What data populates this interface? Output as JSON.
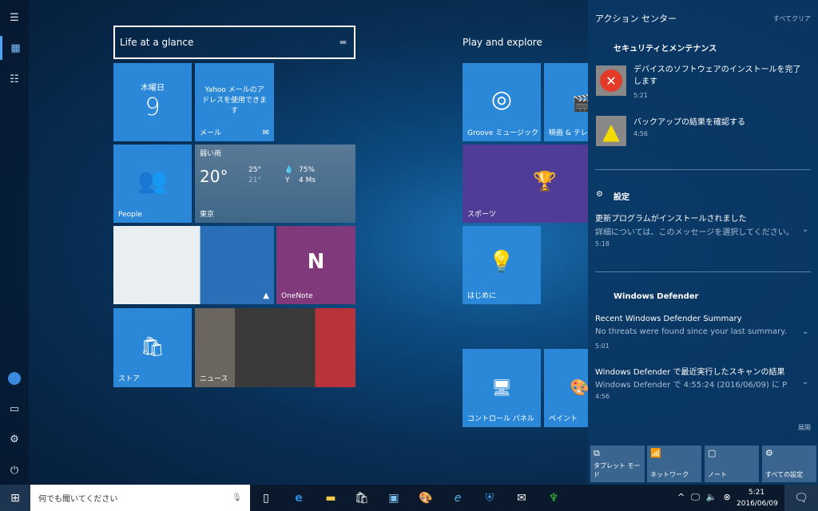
{
  "left_rail": {
    "icons": [
      "hamburger-icon",
      "tiles-icon",
      "all-apps-icon",
      "avatar",
      "file-explorer-icon",
      "settings-icon",
      "power-icon"
    ]
  },
  "groups": [
    {
      "title": "Life at a glance"
    },
    {
      "title": "Play and explore"
    }
  ],
  "tiles": {
    "calendar": {
      "day": "木曜日",
      "date": "9"
    },
    "mail": {
      "text": "Yahoo メールのアドレスを使用できます",
      "label": "メール"
    },
    "people": {
      "label": "People"
    },
    "weather": {
      "condition": "弱い雨",
      "temp": "20°",
      "high": "25°",
      "low": "21°",
      "humidity": "75%",
      "wind": "4 Ms",
      "city": "東京"
    },
    "onenote": {
      "label": "OneNote"
    },
    "store": {
      "label": "ストア"
    },
    "news": {
      "label": "ニュース"
    },
    "groove": {
      "label": "Groove ミュージック"
    },
    "movies": {
      "label": "映画 & テレビ"
    },
    "sports": {
      "label": "スポーツ"
    },
    "getstarted": {
      "label": "はじめに"
    },
    "control": {
      "label": "コントロール パネル"
    },
    "paint": {
      "label": "ペイント"
    }
  },
  "action_center": {
    "title": "アクション センター",
    "clear_all": "すべてクリア",
    "expand": "展開",
    "security": {
      "header": "セキュリティとメンテナンス",
      "items": [
        {
          "title": "デバイスのソフトウェアのインストールを完了します",
          "time": "5:21"
        },
        {
          "title": "バックアップの結果を確認する",
          "time": "4:56"
        }
      ]
    },
    "settings": {
      "header": "設定",
      "title": "更新プログラムがインストールされました",
      "body": "詳細については、このメッセージを選択してください。",
      "time": "5:18"
    },
    "defender": {
      "header": "Windows Defender",
      "items": [
        {
          "title": "Recent Windows Defender Summary",
          "body": "No threats were found since your last summary.",
          "time": "5:01"
        },
        {
          "title": "Windows Defender で最近実行したスキャンの結果",
          "body": "Windows Defender で 4:55:24 (2016/06/09) に P",
          "time": "4:56"
        }
      ]
    },
    "quick_actions": [
      "タブレット モード",
      "ネットワーク",
      "ノート",
      "すべての設定"
    ]
  },
  "taskbar": {
    "search_placeholder": "何でも聞いてください",
    "time": "5:21",
    "date": "2016/06/09"
  },
  "colors": {
    "tile": "#2b88d8",
    "sports": "#4f3c97",
    "onenote": "#80397b"
  }
}
